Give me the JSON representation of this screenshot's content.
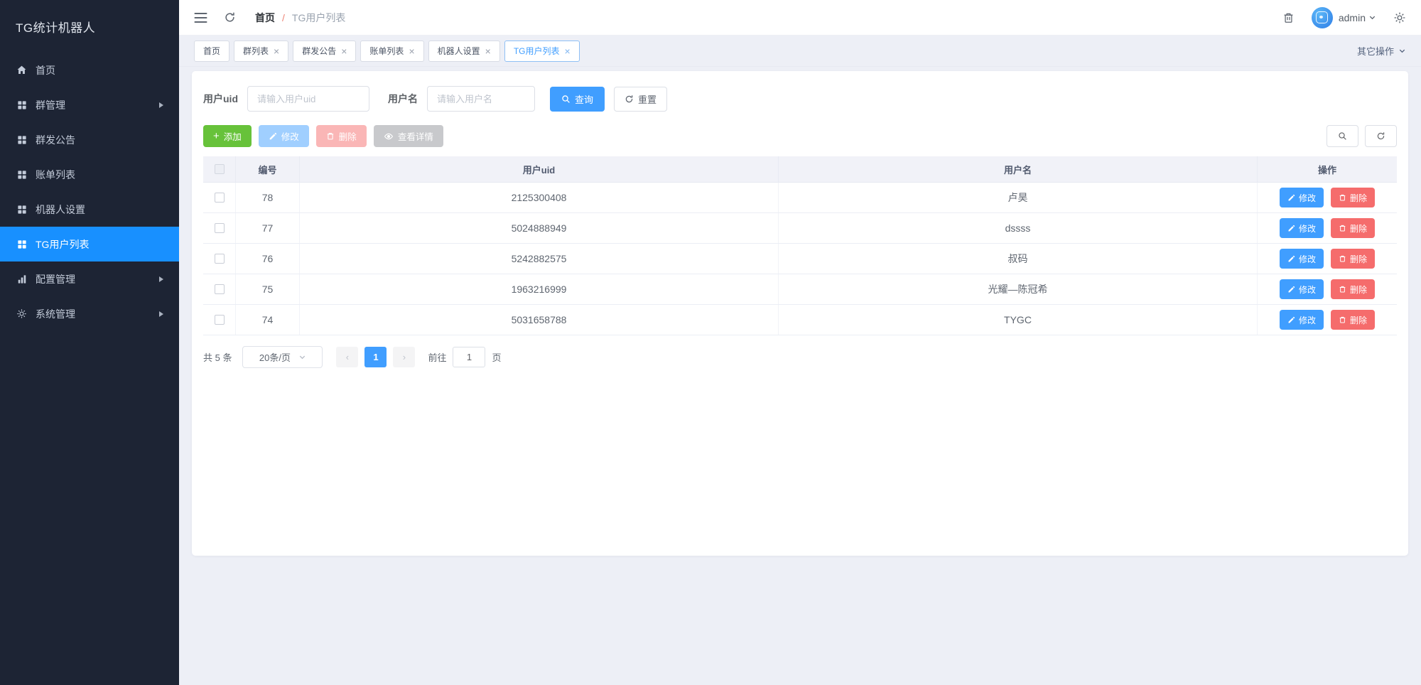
{
  "app": {
    "title": "TG统计机器人"
  },
  "colors": {
    "accent": "#409eff",
    "sidebar_bg": "#1d2434",
    "active_menu": "#1890ff",
    "success": "#67c23a",
    "danger": "#f56c6c",
    "breadcrumb_separator": "#ee8576"
  },
  "sidebar": {
    "items": [
      {
        "label": "首页",
        "icon": "home-icon",
        "active": false,
        "arrow": false
      },
      {
        "label": "群管理",
        "icon": "grid-icon",
        "active": false,
        "arrow": true
      },
      {
        "label": "群发公告",
        "icon": "grid-icon",
        "active": false,
        "arrow": false
      },
      {
        "label": "账单列表",
        "icon": "grid-icon",
        "active": false,
        "arrow": false
      },
      {
        "label": "机器人设置",
        "icon": "grid-icon",
        "active": false,
        "arrow": false
      },
      {
        "label": "TG用户列表",
        "icon": "grid-icon",
        "active": true,
        "arrow": false
      },
      {
        "label": "配置管理",
        "icon": "chart-icon",
        "active": false,
        "arrow": true
      },
      {
        "label": "系统管理",
        "icon": "gear-icon",
        "active": false,
        "arrow": true
      }
    ]
  },
  "topbar": {
    "breadcrumb": {
      "root": "首页",
      "separator": "/",
      "current": "TG用户列表"
    },
    "user": "admin"
  },
  "tabs": {
    "items": [
      {
        "label": "首页",
        "closable": false,
        "active": false
      },
      {
        "label": "群列表",
        "closable": true,
        "active": false
      },
      {
        "label": "群发公告",
        "closable": true,
        "active": false
      },
      {
        "label": "账单列表",
        "closable": true,
        "active": false
      },
      {
        "label": "机器人设置",
        "closable": true,
        "active": false
      },
      {
        "label": "TG用户列表",
        "closable": true,
        "active": true
      }
    ],
    "more_label": "其它操作"
  },
  "filters": {
    "uid_label": "用户uid",
    "uid_placeholder": "请输入用户uid",
    "name_label": "用户名",
    "name_placeholder": "请输入用户名",
    "search_label": "查询",
    "reset_label": "重置"
  },
  "toolbar": {
    "add_label": "添加",
    "edit_label": "修改",
    "delete_label": "删除",
    "detail_label": "查看详情"
  },
  "icons": {
    "topbar": [
      "menu-icon",
      "refresh-icon",
      "trash-icon",
      "avatar",
      "chevron-down-icon",
      "gear-icon"
    ],
    "filter": [
      "search-icon",
      "refresh-icon"
    ],
    "toolbar": [
      "plus-icon",
      "pencil-icon",
      "trash-icon",
      "eye-icon"
    ],
    "table_tools": [
      "search-icon",
      "refresh-icon"
    ],
    "row_actions": [
      "pencil-icon",
      "trash-icon"
    ]
  },
  "table": {
    "headers": [
      "编号",
      "用户uid",
      "用户名",
      "操作"
    ],
    "row_edit_label": "修改",
    "row_delete_label": "删除",
    "rows": [
      {
        "id": "78",
        "uid": "2125300408",
        "name": "卢昊"
      },
      {
        "id": "77",
        "uid": "5024888949",
        "name": "dssss"
      },
      {
        "id": "76",
        "uid": "5242882575",
        "name": "叔码"
      },
      {
        "id": "75",
        "uid": "1963216999",
        "name": "光耀—陈冠希"
      },
      {
        "id": "74",
        "uid": "5031658788",
        "name": "TYGC"
      }
    ]
  },
  "pagination": {
    "total_text": "共 5 条",
    "page_size": "20条/页",
    "prev": "‹",
    "current_page": "1",
    "next": "›",
    "goto_label": "前往",
    "goto_value": "1",
    "page_suffix": "页"
  }
}
